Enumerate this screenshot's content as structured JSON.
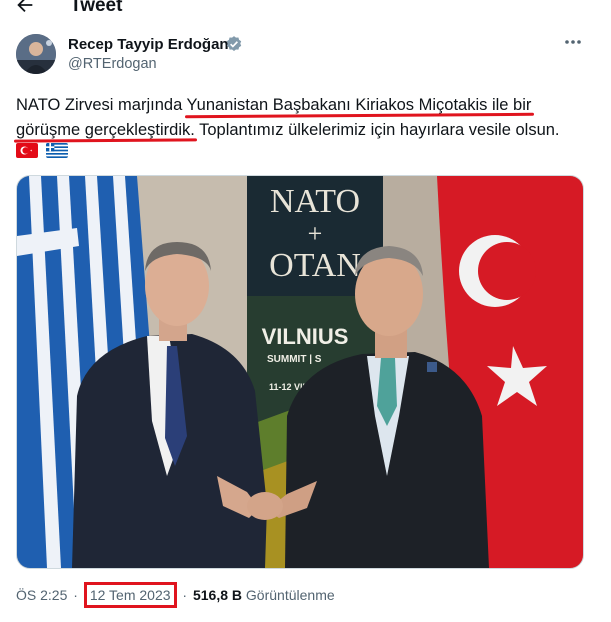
{
  "header": {
    "title": "Tweet",
    "back_icon": "arrow-left-icon"
  },
  "author": {
    "name": "Recep Tayyip Erdoğan",
    "handle": "@RTErdogan",
    "verified_color": "#829aab"
  },
  "tweet": {
    "text_1": "NATO Zirvesi marjında ",
    "text_highlight_1": "Yunanistan Başbakanı Kiriakos Miçotakis ile bir",
    "text_highlight_2": "görüşme gerçekleştirdik.",
    "text_2": " Toplantımız ülkelerimiz için hayırlara vesile olsun.",
    "flags": [
      "turkey-flag-icon",
      "greece-flag-icon"
    ],
    "highlight_color": "#e0141e"
  },
  "photo": {
    "backdrop_nato": "NATO",
    "backdrop_plus": "+",
    "backdrop_otan": "OTAN",
    "backdrop_city": "VILNIUS",
    "backdrop_summit": "SUMMIT | S",
    "backdrop_dates": "11-12 VII"
  },
  "meta": {
    "time": "ÖS 2:25",
    "separator": "·",
    "date": "12 Tem 2023",
    "views_count": "516,8 B",
    "views_label": "Görüntülenme"
  }
}
